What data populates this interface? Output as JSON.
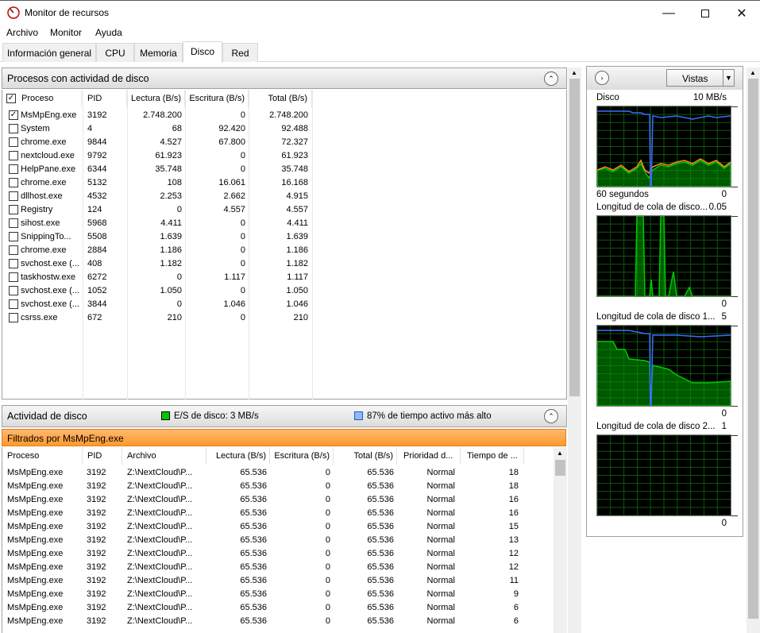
{
  "window": {
    "title": "Monitor de recursos"
  },
  "menu": [
    "Archivo",
    "Monitor",
    "Ayuda"
  ],
  "tabs": [
    "Información general",
    "CPU",
    "Memoria",
    "Disco",
    "Red"
  ],
  "active_tab": "Disco",
  "processes_panel": {
    "title": "Procesos con actividad de disco",
    "columns": [
      "Proceso",
      "PID",
      "Lectura (B/s)",
      "Escritura (B/s)",
      "Total (B/s)"
    ],
    "rows": [
      {
        "checked": true,
        "name": "MsMpEng.exe",
        "pid": "3192",
        "read": "2.748.200",
        "write": "0",
        "total": "2.748.200"
      },
      {
        "checked": false,
        "name": "System",
        "pid": "4",
        "read": "68",
        "write": "92.420",
        "total": "92.488"
      },
      {
        "checked": false,
        "name": "chrome.exe",
        "pid": "9844",
        "read": "4.527",
        "write": "67.800",
        "total": "72.327"
      },
      {
        "checked": false,
        "name": "nextcloud.exe",
        "pid": "9792",
        "read": "61.923",
        "write": "0",
        "total": "61.923"
      },
      {
        "checked": false,
        "name": "HelpPane.exe",
        "pid": "6344",
        "read": "35.748",
        "write": "0",
        "total": "35.748"
      },
      {
        "checked": false,
        "name": "chrome.exe",
        "pid": "5132",
        "read": "108",
        "write": "16.061",
        "total": "16.168"
      },
      {
        "checked": false,
        "name": "dllhost.exe",
        "pid": "4532",
        "read": "2.253",
        "write": "2.662",
        "total": "4.915"
      },
      {
        "checked": false,
        "name": "Registry",
        "pid": "124",
        "read": "0",
        "write": "4.557",
        "total": "4.557"
      },
      {
        "checked": false,
        "name": "sihost.exe",
        "pid": "5968",
        "read": "4.411",
        "write": "0",
        "total": "4.411"
      },
      {
        "checked": false,
        "name": "SnippingTo...",
        "pid": "5508",
        "read": "1.639",
        "write": "0",
        "total": "1.639"
      },
      {
        "checked": false,
        "name": "chrome.exe",
        "pid": "2884",
        "read": "1.186",
        "write": "0",
        "total": "1.186"
      },
      {
        "checked": false,
        "name": "svchost.exe (...",
        "pid": "408",
        "read": "1.182",
        "write": "0",
        "total": "1.182"
      },
      {
        "checked": false,
        "name": "taskhostw.exe",
        "pid": "6272",
        "read": "0",
        "write": "1.117",
        "total": "1.117"
      },
      {
        "checked": false,
        "name": "svchost.exe (...",
        "pid": "1052",
        "read": "1.050",
        "write": "0",
        "total": "1.050"
      },
      {
        "checked": false,
        "name": "svchost.exe (...",
        "pid": "3844",
        "read": "0",
        "write": "1.046",
        "total": "1.046"
      },
      {
        "checked": false,
        "name": "csrss.exe",
        "pid": "672",
        "read": "210",
        "write": "0",
        "total": "210"
      }
    ]
  },
  "disk_activity": {
    "title": "Actividad de disco",
    "io_label": "E/S de disco: 3 MB/s",
    "active_label": "87% de tiempo activo más alto",
    "filter": "Filtrados por MsMpEng.exe",
    "columns": [
      "Proceso",
      "PID",
      "Archivo",
      "Lectura (B/s)",
      "Escritura (B/s)",
      "Total (B/s)",
      "Prioridad d...",
      "Tiempo de ..."
    ],
    "rows": [
      {
        "name": "MsMpEng.exe",
        "pid": "3192",
        "file": "Z:\\NextCloud\\P...",
        "read": "65.536",
        "write": "0",
        "total": "65.536",
        "prio": "Normal",
        "time": "18"
      },
      {
        "name": "MsMpEng.exe",
        "pid": "3192",
        "file": "Z:\\NextCloud\\P...",
        "read": "65.536",
        "write": "0",
        "total": "65.536",
        "prio": "Normal",
        "time": "18"
      },
      {
        "name": "MsMpEng.exe",
        "pid": "3192",
        "file": "Z:\\NextCloud\\P...",
        "read": "65.536",
        "write": "0",
        "total": "65.536",
        "prio": "Normal",
        "time": "16"
      },
      {
        "name": "MsMpEng.exe",
        "pid": "3192",
        "file": "Z:\\NextCloud\\P...",
        "read": "65.536",
        "write": "0",
        "total": "65.536",
        "prio": "Normal",
        "time": "16"
      },
      {
        "name": "MsMpEng.exe",
        "pid": "3192",
        "file": "Z:\\NextCloud\\P...",
        "read": "65.536",
        "write": "0",
        "total": "65.536",
        "prio": "Normal",
        "time": "15"
      },
      {
        "name": "MsMpEng.exe",
        "pid": "3192",
        "file": "Z:\\NextCloud\\P...",
        "read": "65.536",
        "write": "0",
        "total": "65.536",
        "prio": "Normal",
        "time": "13"
      },
      {
        "name": "MsMpEng.exe",
        "pid": "3192",
        "file": "Z:\\NextCloud\\P...",
        "read": "65.536",
        "write": "0",
        "total": "65.536",
        "prio": "Normal",
        "time": "12"
      },
      {
        "name": "MsMpEng.exe",
        "pid": "3192",
        "file": "Z:\\NextCloud\\P...",
        "read": "65.536",
        "write": "0",
        "total": "65.536",
        "prio": "Normal",
        "time": "12"
      },
      {
        "name": "MsMpEng.exe",
        "pid": "3192",
        "file": "Z:\\NextCloud\\P...",
        "read": "65.536",
        "write": "0",
        "total": "65.536",
        "prio": "Normal",
        "time": "11"
      },
      {
        "name": "MsMpEng.exe",
        "pid": "3192",
        "file": "Z:\\NextCloud\\P...",
        "read": "65.536",
        "write": "0",
        "total": "65.536",
        "prio": "Normal",
        "time": "9"
      },
      {
        "name": "MsMpEng.exe",
        "pid": "3192",
        "file": "Z:\\NextCloud\\P...",
        "read": "65.536",
        "write": "0",
        "total": "65.536",
        "prio": "Normal",
        "time": "6"
      },
      {
        "name": "MsMpEng.exe",
        "pid": "3192",
        "file": "Z:\\NextCloud\\P...",
        "read": "65.536",
        "write": "0",
        "total": "65.536",
        "prio": "Normal",
        "time": "6"
      }
    ]
  },
  "graphs": {
    "views_button": "Vistas",
    "items": [
      {
        "title": "Disco",
        "max": "10 MB/s",
        "footer_left": "60 segundos",
        "footer_right": "0"
      },
      {
        "title": "Longitud de cola de disco...",
        "max": "0.05",
        "footer_right": "0"
      },
      {
        "title": "Longitud de cola de disco 1...",
        "max": "5",
        "footer_right": "0"
      },
      {
        "title": "Longitud de cola de disco 2...",
        "max": "1",
        "footer_right": "0"
      }
    ]
  },
  "colors": {
    "accent_orange": "#ff9a2a",
    "graph_green": "#00c800",
    "graph_blue": "#3a6cff",
    "graph_orange": "#ff8c1a"
  }
}
